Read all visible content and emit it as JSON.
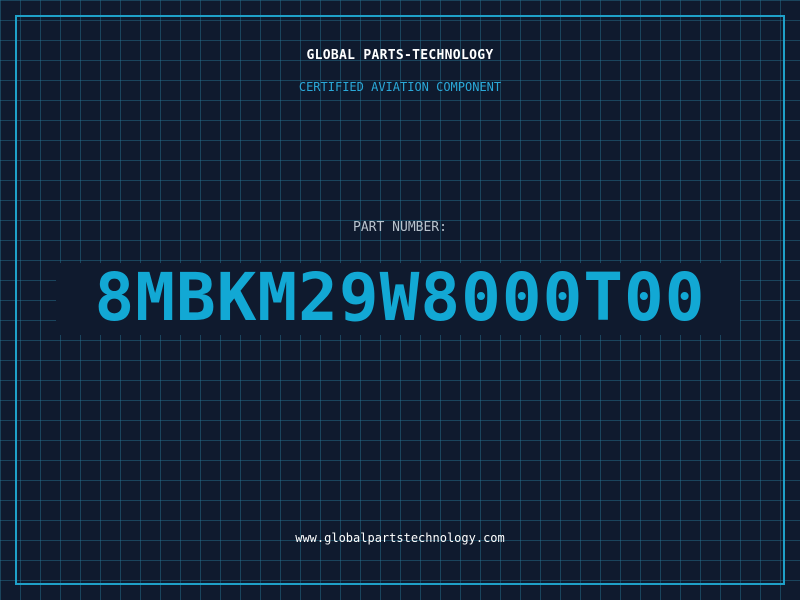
{
  "label": {
    "brand": "GLOBAL PARTS-TECHNOLOGY",
    "subtitle": "CERTIFIED AVIATION COMPONENT",
    "part_number_label": "PART NUMBER:",
    "part_number": "8MBKM29W8000T00",
    "website": "www.globalpartstechnology.com"
  },
  "colors": {
    "background": "#0f1a2e",
    "grid": "#1e6a85",
    "accent": "#12a8d4",
    "text": "#ffffff"
  }
}
